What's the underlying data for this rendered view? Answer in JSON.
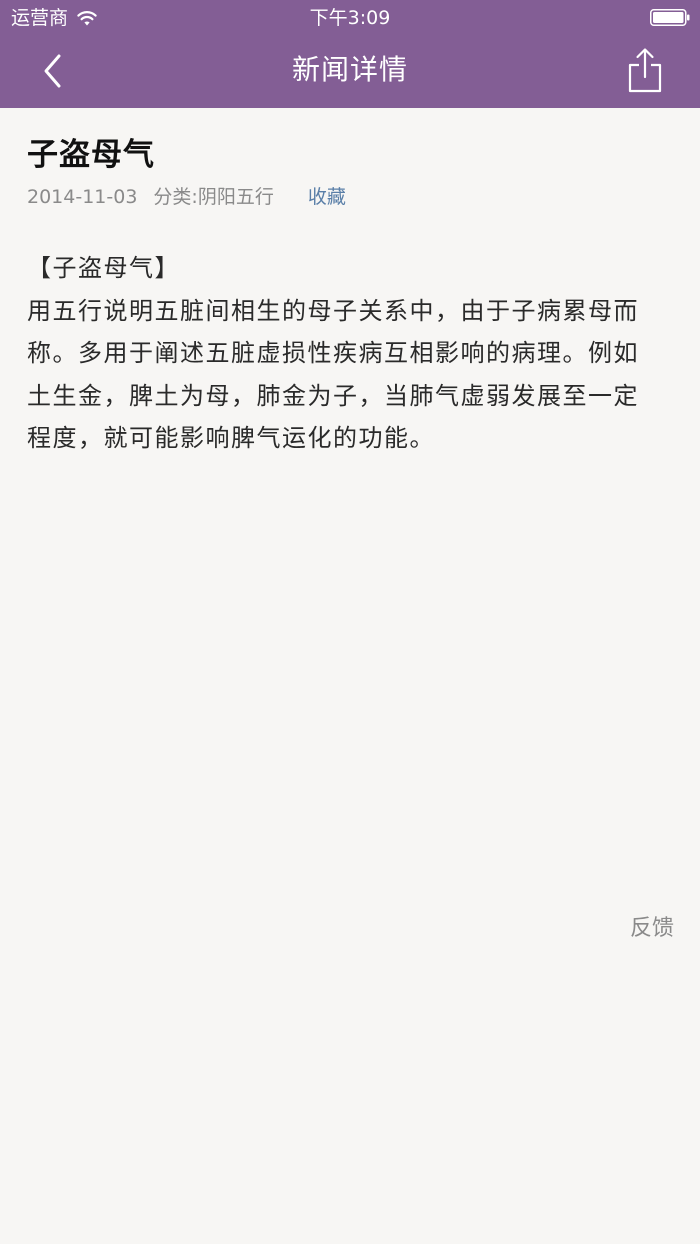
{
  "status_bar": {
    "carrier": "运营商",
    "time": "下午3:09"
  },
  "nav": {
    "title": "新闻详情",
    "back_icon": "chevron-left-icon",
    "share_icon": "share-icon"
  },
  "article": {
    "title": "子盗母气",
    "date": "2014-11-03",
    "category": "分类:阴阳五行",
    "favorite_label": "收藏",
    "body_lines": [
      "【子盗母气】",
      "用五行说明五脏间相生的母子关系中，由于子病累母而",
      "称。多用于阐述五脏虚损性疾病互相影响的病理。例如",
      "土生金，脾土为母，肺金为子，当肺气虚弱发展至一定",
      "程度，就可能影响脾气运化的功能。"
    ]
  },
  "footer": {
    "feedback_label": "反馈"
  },
  "colors": {
    "nav_background": "#835e95",
    "page_background": "#f7f6f4",
    "link": "#5a7fa8",
    "muted_text": "#8a8a8a"
  }
}
